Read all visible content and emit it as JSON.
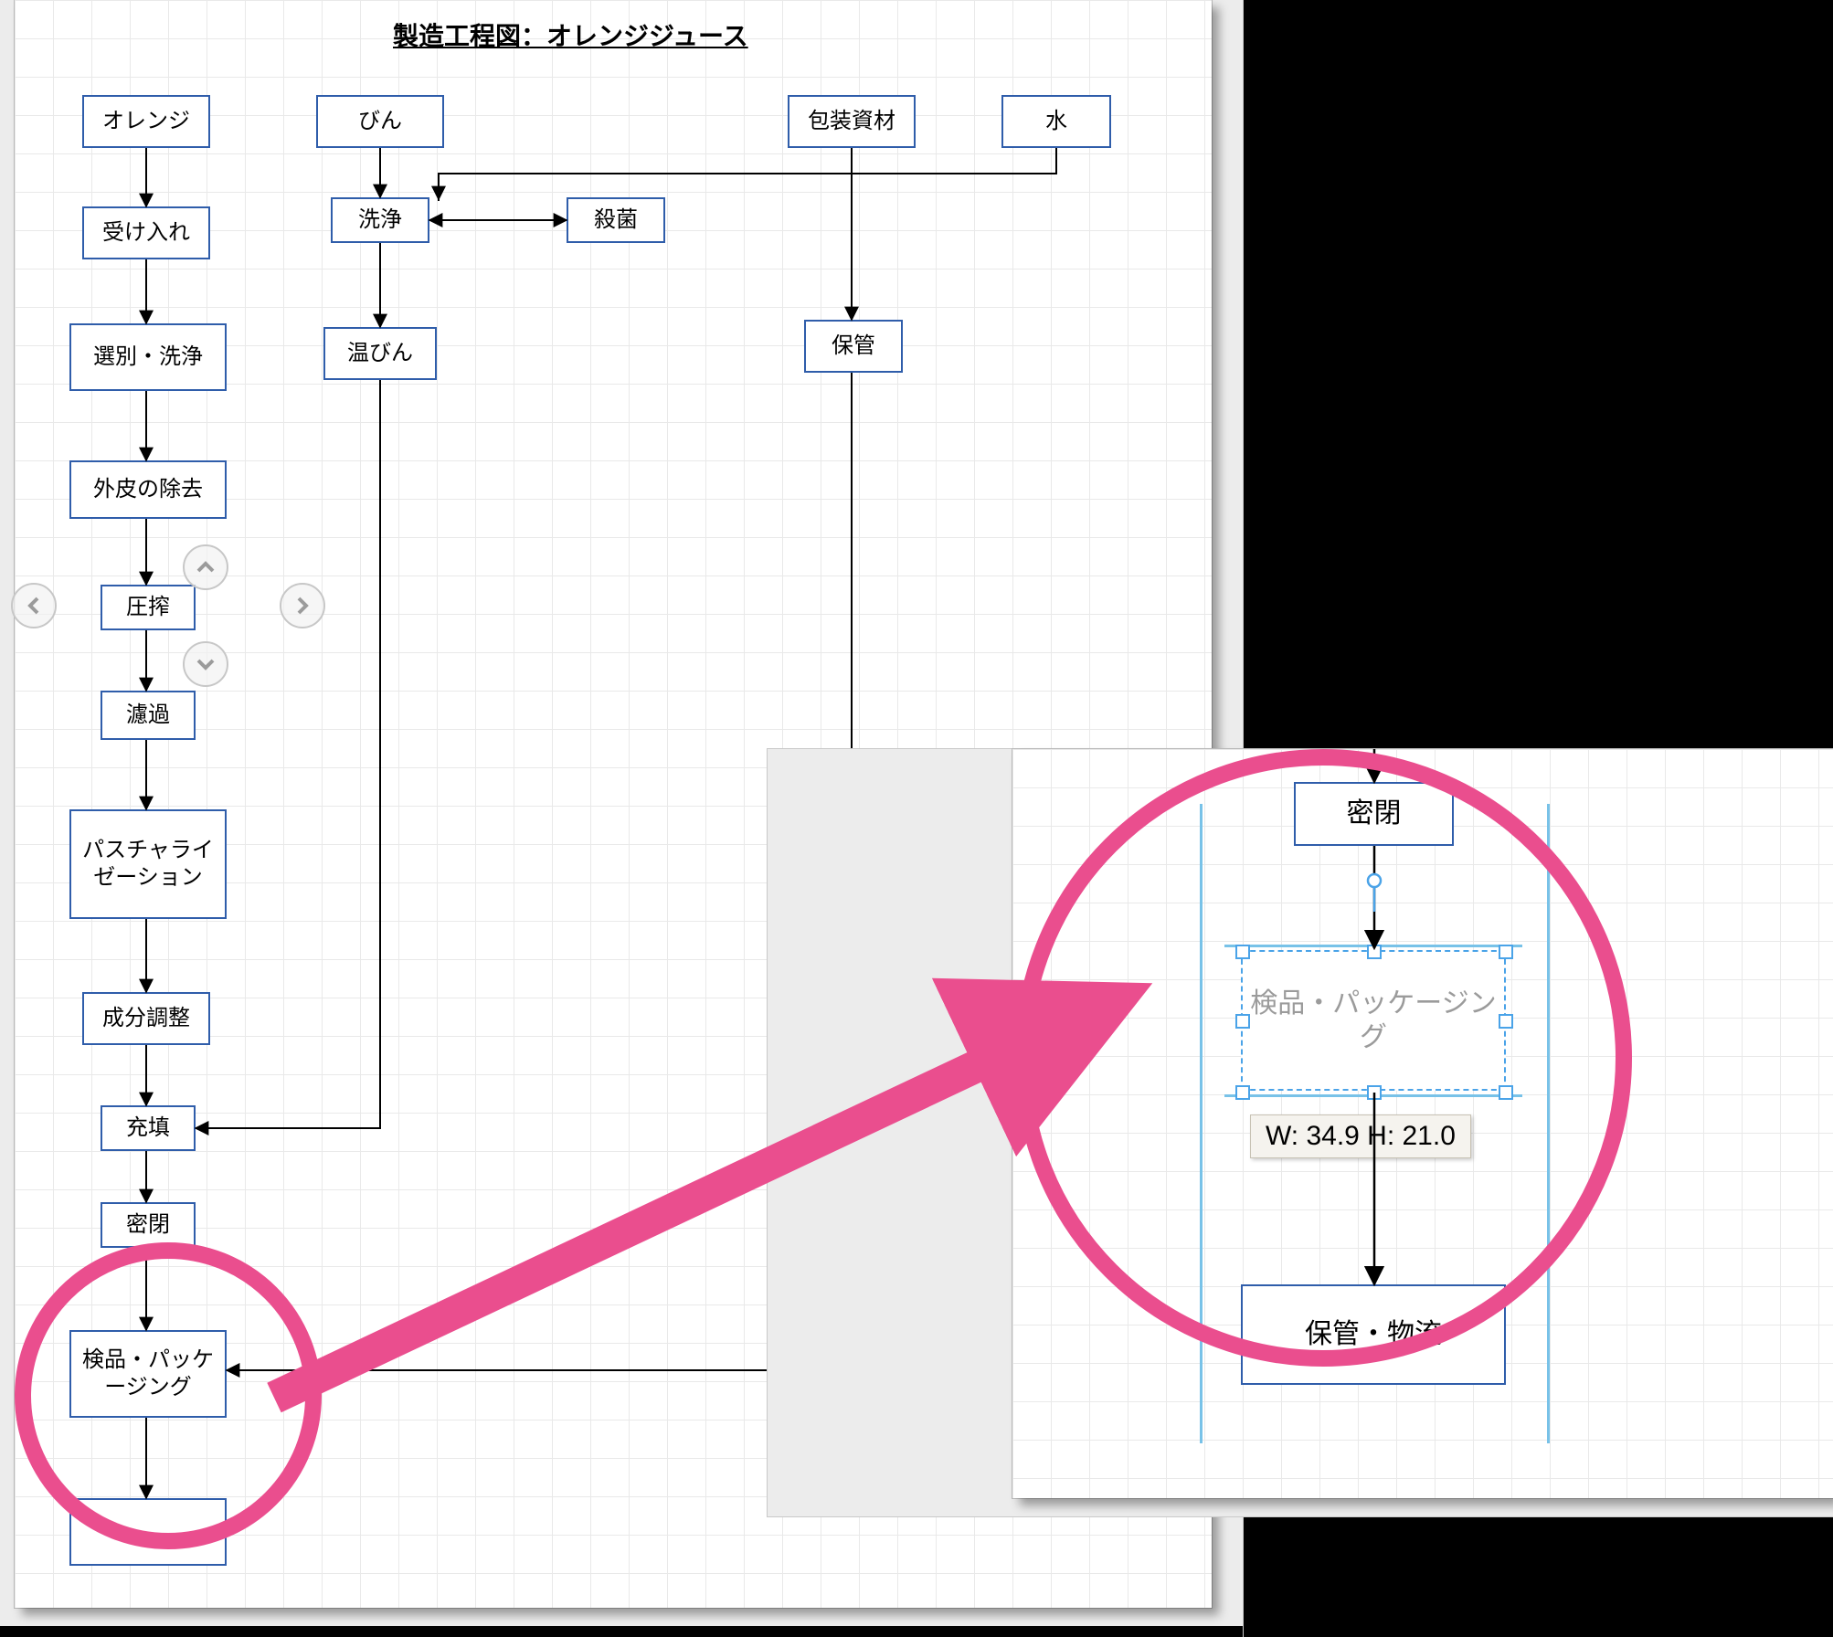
{
  "title": "製造工程図：オレンジジュース",
  "nodes": {
    "orange": "オレンジ",
    "ukeire": "受け入れ",
    "senbetsu": "選別・洗浄",
    "gaihi": "外皮の除去",
    "assaku": "圧搾",
    "roka": "濾過",
    "pasteur": "パスチャライゼーション",
    "seibun": "成分調整",
    "juten": "充填",
    "mippei": "密閉",
    "kenpin": "検品・パッケージング",
    "hokanB": "保管・物流",
    "bin": "びん",
    "senjo": "洗浄",
    "sakkin": "殺菌",
    "onbin": "温びん",
    "hosozai": "包装資材",
    "mizu": "水",
    "hokan": "保管"
  },
  "zoom": {
    "mippei": "密閉",
    "kenpin": "検品・パッケージング",
    "hokanB": "保管・物流",
    "size_label": "W: 34.9 H: 21.0"
  },
  "selection_size": {
    "W": 34.9,
    "H": 21.0
  }
}
